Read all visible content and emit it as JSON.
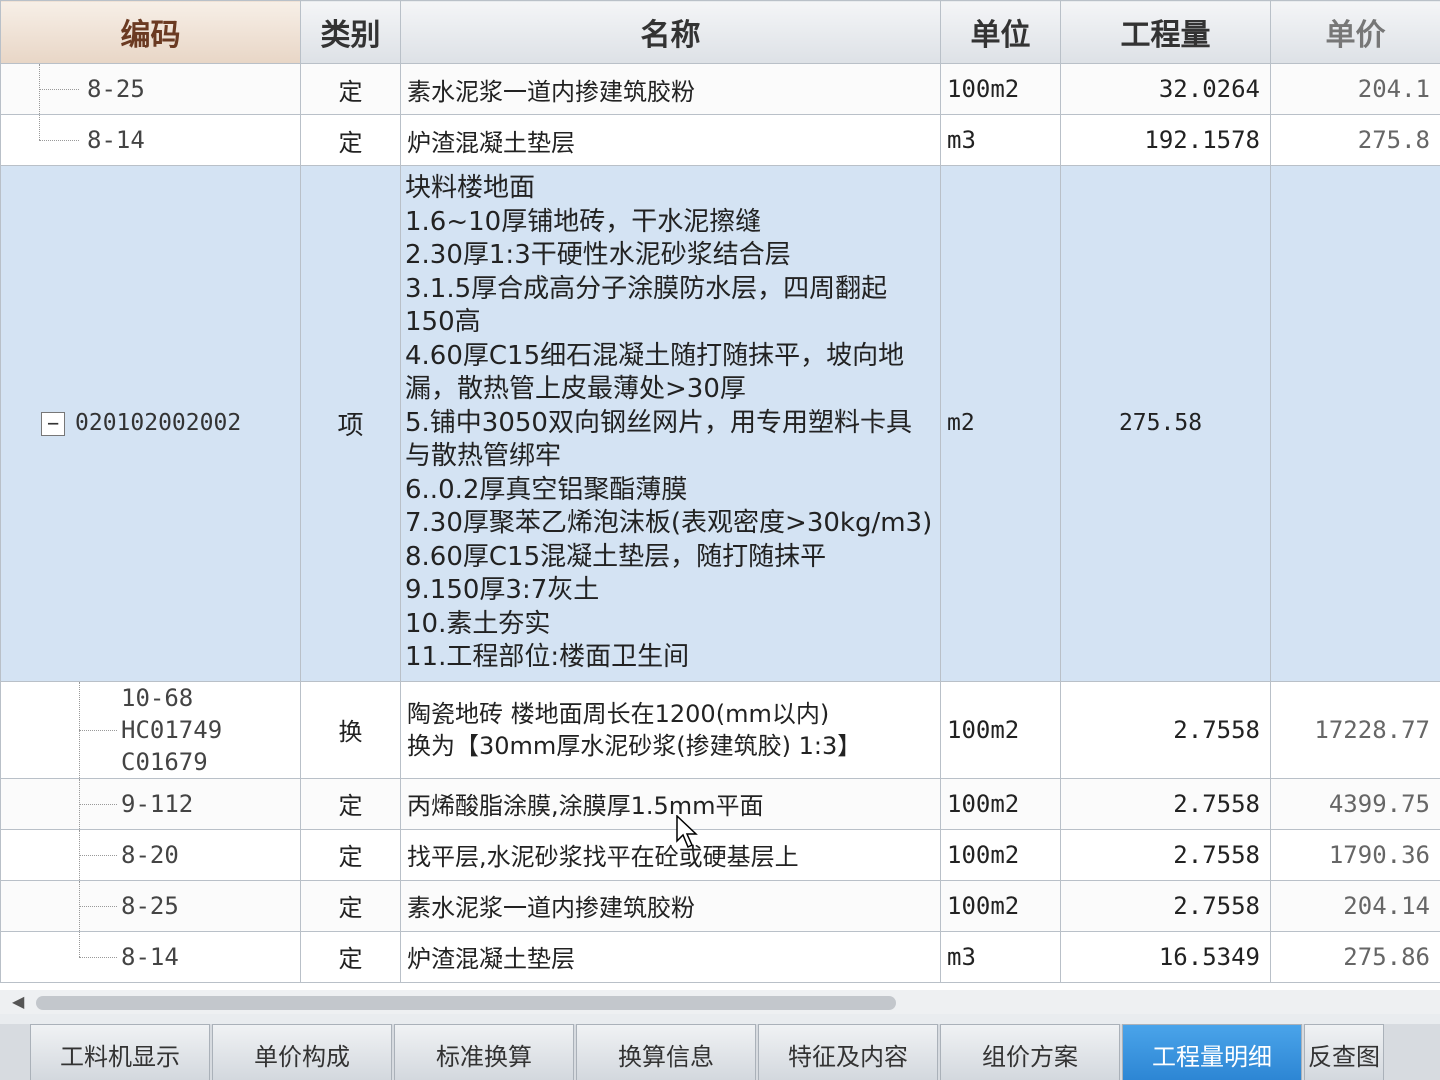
{
  "columns": {
    "code": "编码",
    "type": "类别",
    "name": "名称",
    "unit": "单位",
    "qty": "工程量",
    "price": "单价"
  },
  "top_rows": [
    {
      "code": "8-25",
      "type": "定",
      "name": "素水泥浆一道内掺建筑胶粉",
      "unit": "100m2",
      "qty": "32.0264",
      "price": "204.1"
    },
    {
      "code": "8-14",
      "type": "定",
      "name": "炉渣混凝土垫层",
      "unit": "m3",
      "qty": "192.1578",
      "price": "275.8"
    }
  ],
  "item": {
    "toggle": "−",
    "code": "020102002002",
    "type": "项",
    "unit": "m2",
    "qty": "275.58",
    "price": "",
    "desc": [
      "块料楼地面",
      "1.6~10厚铺地砖，干水泥擦缝",
      "2.30厚1:3干硬性水泥砂浆结合层",
      "3.1.5厚合成高分子涂膜防水层，四周翻起150高",
      "4.60厚C15细石混凝土随打随抹平，坡向地漏，散热管上皮最薄处>30厚",
      "5.铺中3050双向钢丝网片，用专用塑料卡具与散热管绑牢",
      "6..0.2厚真空铝聚酯薄膜",
      "7.30厚聚苯乙烯泡沫板(表观密度>30kg/m3)",
      "8.60厚C15混凝土垫层，随打随抹平",
      "9.150厚3:7灰土",
      "10.素土夯实",
      "11.工程部位:楼面卫生间"
    ]
  },
  "sub_rows": [
    {
      "code_line1": "10-68 HC01749",
      "code_line2": "C01679",
      "type": "换",
      "name_line1": "陶瓷地砖 楼地面周长在1200(mm以内)",
      "name_line2": "换为【30mm厚水泥砂浆(掺建筑胶) 1:3】",
      "unit": "100m2",
      "qty": "2.7558",
      "price": "17228.77"
    },
    {
      "code": "9-112",
      "type": "定",
      "name": "丙烯酸脂涂膜,涂膜厚1.5mm平面",
      "unit": "100m2",
      "qty": "2.7558",
      "price": "4399.75"
    },
    {
      "code": "8-20",
      "type": "定",
      "name": "找平层,水泥砂浆找平在砼或硬基层上",
      "unit": "100m2",
      "qty": "2.7558",
      "price": "1790.36"
    },
    {
      "code": "8-25",
      "type": "定",
      "name": "素水泥浆一道内掺建筑胶粉",
      "unit": "100m2",
      "qty": "2.7558",
      "price": "204.14"
    },
    {
      "code": "8-14",
      "type": "定",
      "name": "炉渣混凝土垫层",
      "unit": "m3",
      "qty": "16.5349",
      "price": "275.86"
    }
  ],
  "tabs": [
    "工料机显示",
    "单价构成",
    "标准换算",
    "换算信息",
    "特征及内容",
    "组价方案",
    "工程量明细",
    "反查图"
  ],
  "active_tab": "工程量明细",
  "scroll_left_arrow": "◀"
}
